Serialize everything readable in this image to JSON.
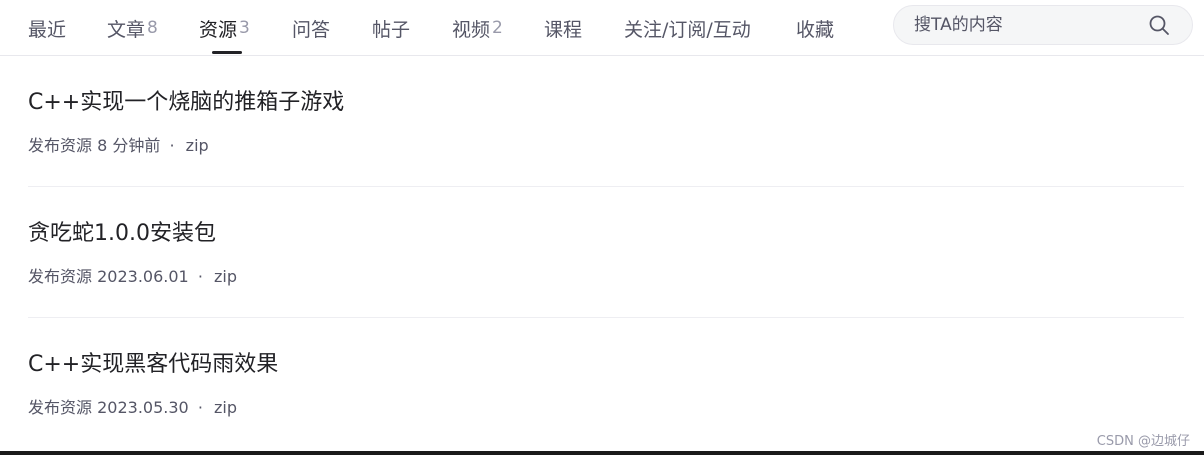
{
  "tabs": [
    {
      "label": "最近",
      "count": ""
    },
    {
      "label": "文章",
      "count": "8"
    },
    {
      "label": "资源",
      "count": "3"
    },
    {
      "label": "问答",
      "count": ""
    },
    {
      "label": "帖子",
      "count": ""
    },
    {
      "label": "视频",
      "count": "2"
    },
    {
      "label": "课程",
      "count": ""
    },
    {
      "label": "关注/订阅/互动",
      "count": ""
    },
    {
      "label": "收藏",
      "count": ""
    }
  ],
  "active_tab": "资源",
  "search": {
    "placeholder": "搜TA的内容",
    "value": "",
    "icon": "search-icon"
  },
  "resources": [
    {
      "title": "C++实现一个烧脑的推箱子游戏",
      "action": "发布资源",
      "time": "8 分钟前",
      "sep": "·",
      "type": "zip"
    },
    {
      "title": "贪吃蛇1.0.0安装包",
      "action": "发布资源",
      "time": "2023.06.01",
      "sep": "·",
      "type": "zip"
    },
    {
      "title": "C++实现黑客代码雨效果",
      "action": "发布资源",
      "time": "2023.05.30",
      "sep": "·",
      "type": "zip"
    }
  ],
  "watermark": "CSDN @边城仔",
  "colors": {
    "text_primary": "#222226",
    "text_secondary": "#555666",
    "count": "#999aaa",
    "divider": "#eeeef2",
    "search_bg": "#f5f6f7"
  }
}
